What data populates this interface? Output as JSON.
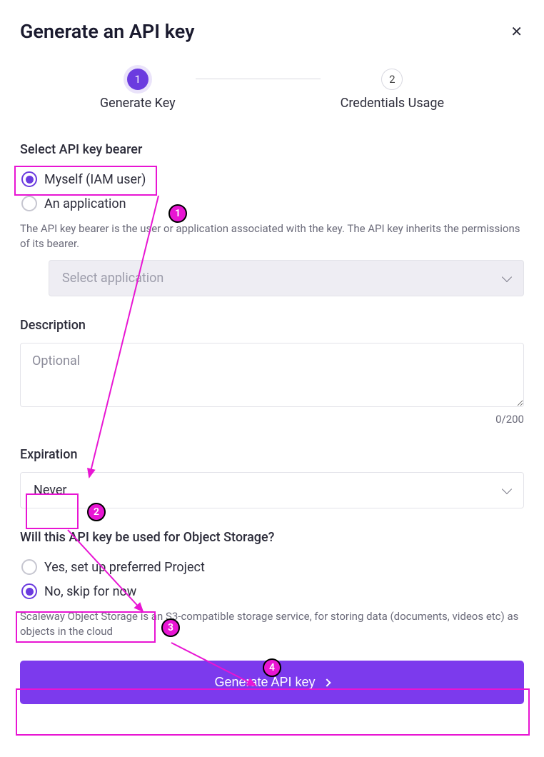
{
  "title": "Generate an API key",
  "stepper": {
    "step1": {
      "num": "1",
      "label": "Generate Key"
    },
    "step2": {
      "num": "2",
      "label": "Credentials Usage"
    }
  },
  "bearer": {
    "heading": "Select API key bearer",
    "option_myself": "Myself (IAM user)",
    "option_app": "An application",
    "help": "The API key bearer is the user or application associated with the key. The API key inherits the permissions of its bearer.",
    "select_placeholder": "Select application"
  },
  "description": {
    "heading": "Description",
    "placeholder": "Optional",
    "counter": "0/200"
  },
  "expiration": {
    "heading": "Expiration",
    "value": "Never"
  },
  "objectstorage": {
    "heading": "Will this API key be used for Object Storage?",
    "option_yes": "Yes, set up preferred Project",
    "option_no": "No, skip for now",
    "help": "Scaleway Object Storage is an S3-compatible storage service, for storing data (documents, videos etc) as objects in the cloud"
  },
  "submit_label": "Generate API key",
  "annotations": {
    "b1": "1",
    "b2": "2",
    "b3": "3",
    "b4": "4"
  }
}
